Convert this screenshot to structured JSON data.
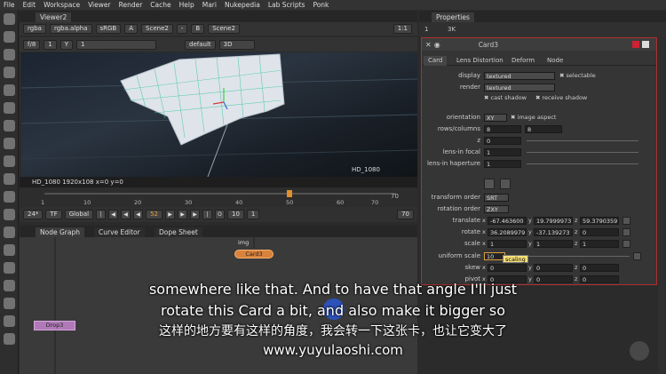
{
  "menu": [
    "File",
    "Edit",
    "Workspace",
    "Viewer",
    "Render",
    "Cache",
    "Help",
    "Mari",
    "Nukepedia",
    "Lab Scripts",
    "Ponk"
  ],
  "viewer": {
    "tab_label": "Viewer2",
    "channels": "rgba",
    "alpha": "rgba.alpha",
    "colorspace": "sRGB",
    "input_a": "Scene2",
    "input_b": "Scene2",
    "a_label": "A",
    "b_label": "B",
    "dash": "-",
    "fstop": "f/8",
    "y_label": "Y",
    "gain": "1",
    "gamma": "1",
    "view_mode": "default",
    "view_3d": "3D",
    "zoom": "1:1",
    "format_overlay": "HD_1080",
    "status": "HD_1080 1920x108  x=0 y=0",
    "status_id": "1"
  },
  "timeline": {
    "ticks": [
      "1",
      "10",
      "20",
      "30",
      "40",
      "50",
      "60",
      "70"
    ],
    "end_frame": "70",
    "fps": "24*",
    "tf": "TF",
    "scope": "Global",
    "current_frame": "52",
    "step": "10",
    "skip": "1",
    "frame_end_field": "70"
  },
  "nodegraph": {
    "tabs": [
      "Node Graph",
      "Curve Editor",
      "Dope Sheet"
    ],
    "card_node": "Card3",
    "drop_node": "Drop3",
    "img_label": "img"
  },
  "properties": {
    "tab_label": "Properties",
    "node_name": "Card3",
    "bar_count": "1",
    "bar_items": "3K",
    "subtabs": [
      "Card",
      "Lens Distortion",
      "Deform",
      "Node"
    ],
    "display": {
      "label": "display",
      "value": "textured",
      "check": "selectable"
    },
    "render": {
      "label": "render",
      "value": "textured"
    },
    "cast_shadow": "cast shadow",
    "receive_shadow": "receive shadow",
    "orientation": {
      "label": "orientation",
      "value": "XY",
      "check": "image aspect"
    },
    "rows_columns": {
      "label": "rows/columns",
      "a": "8",
      "b": "8"
    },
    "z": {
      "label": "z",
      "value": "0"
    },
    "lens_focal": {
      "label": "lens-in focal",
      "value": "1"
    },
    "lens_haperture": {
      "label": "lens-in haperture",
      "value": "1"
    },
    "transform_order": {
      "label": "transform order",
      "value": "SRT"
    },
    "rotation_order": {
      "label": "rotation order",
      "value": "ZXY"
    },
    "translate": {
      "label": "translate",
      "x": "-67.463600",
      "y": "19.7999973",
      "z": "59.3790359"
    },
    "rotate": {
      "label": "rotate",
      "x": "36.2089979",
      "y": "-37.139273",
      "z": "0"
    },
    "scale": {
      "label": "scale",
      "x": "1",
      "y": "1",
      "z": "1"
    },
    "uniform_scale": {
      "label": "uniform scale",
      "value": "10"
    },
    "skew": {
      "label": "skew",
      "x": "0",
      "y": "0",
      "z": "0"
    },
    "pivot": {
      "label": "pivot",
      "x": "0",
      "y": "0",
      "z": "0"
    },
    "tooltip": "scaling",
    "axis_x": "x",
    "axis_y": "y",
    "axis_z": "z"
  },
  "subtitles": {
    "line1": "somewhere like that. And to have that angle I'll just",
    "line2": "rotate this Card a bit, and also make it bigger so",
    "line3": "这样的地方要有这样的角度，我会转一下这张卡，也让它变大了",
    "line4": "www.yuyulaoshi.com"
  },
  "colors": {
    "accent": "#d9823b",
    "panel_border": "#b03030",
    "tooltip": "#f7e07a"
  }
}
